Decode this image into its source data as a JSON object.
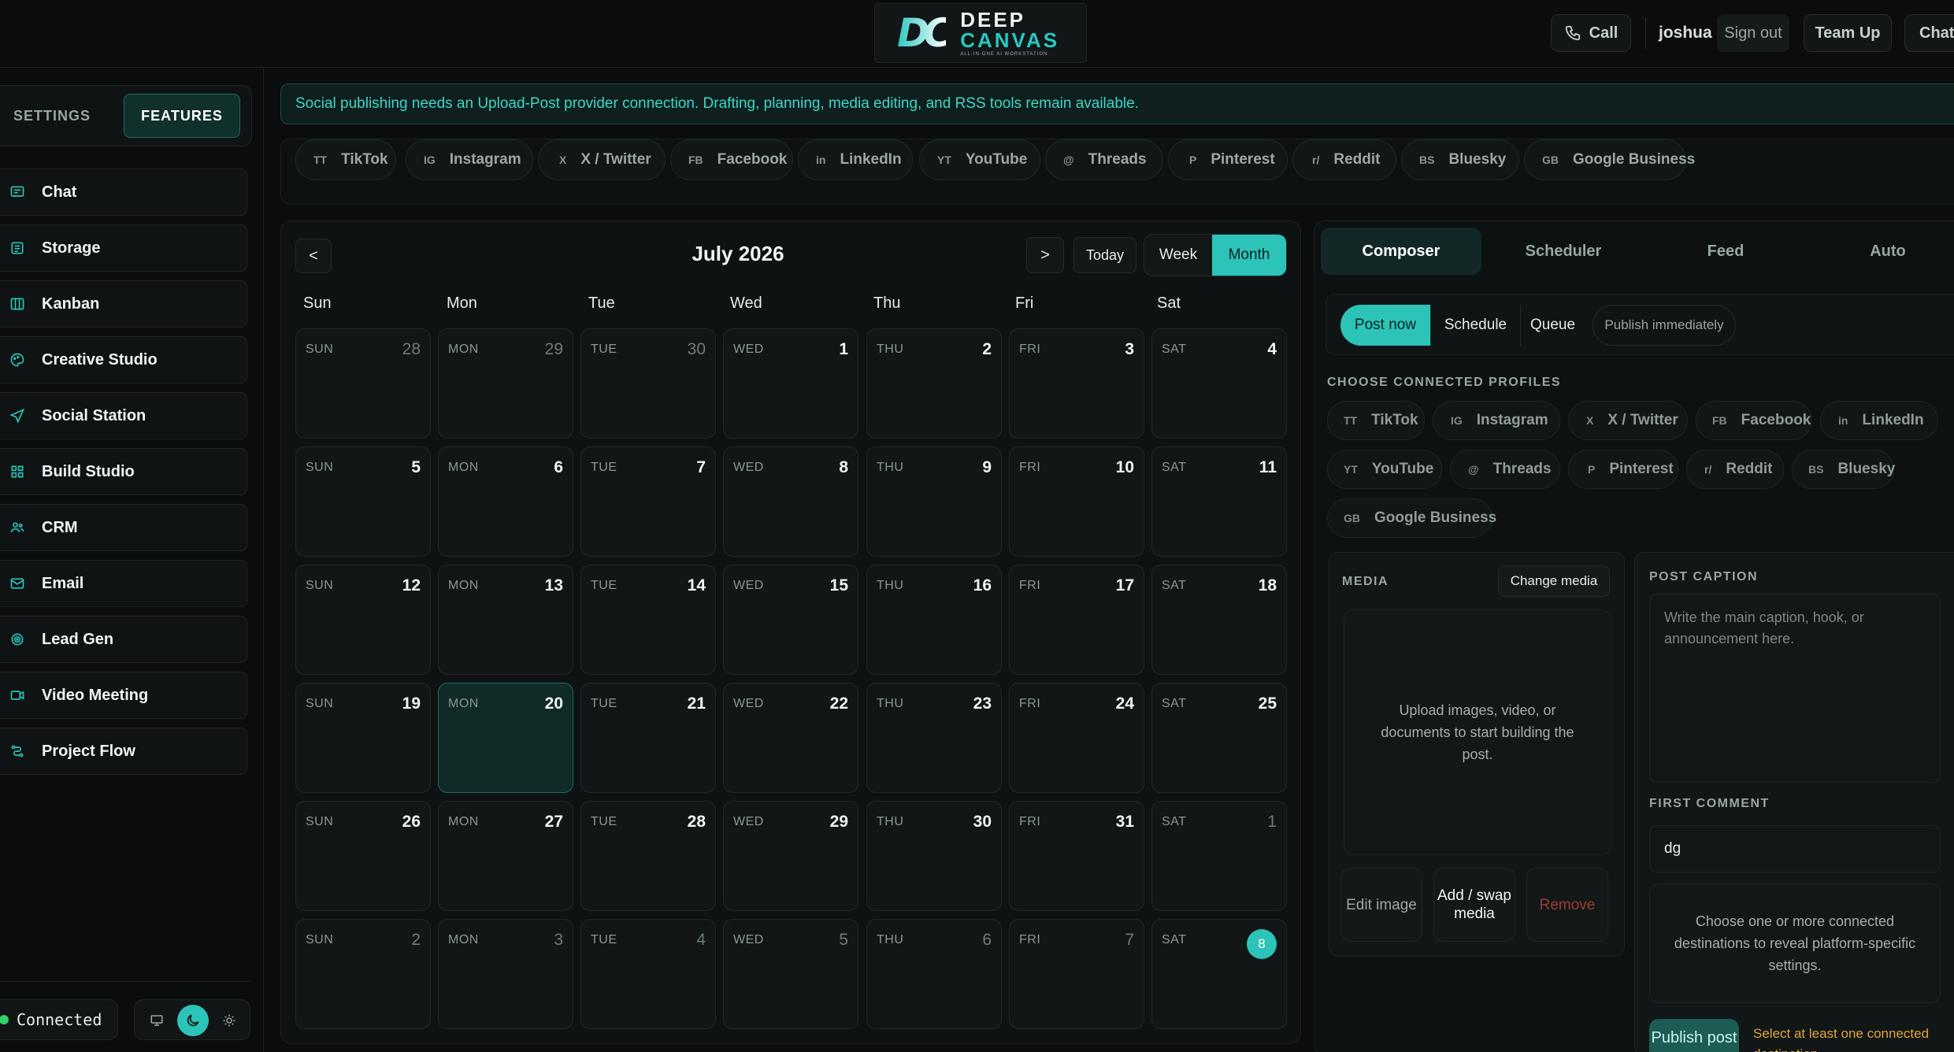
{
  "header": {
    "logo": {
      "mark": "DC",
      "line1": "DEEP",
      "line2": "CANVAS",
      "tagline": "ALL-IN-ONE AI WORKSTATION"
    },
    "call_label": "Call",
    "user": "joshua",
    "sign_out": "Sign out",
    "team_up": "Team Up",
    "chat": "Chat"
  },
  "sidebar": {
    "tabs": {
      "settings": "SETTINGS",
      "features": "FEATURES"
    },
    "items": [
      {
        "label": "Chat",
        "icon": "chat-icon"
      },
      {
        "label": "Storage",
        "icon": "storage-icon"
      },
      {
        "label": "Kanban",
        "icon": "kanban-icon"
      },
      {
        "label": "Creative Studio",
        "icon": "palette-icon"
      },
      {
        "label": "Social Station",
        "icon": "send-icon"
      },
      {
        "label": "Build Studio",
        "icon": "grid-icon"
      },
      {
        "label": "CRM",
        "icon": "users-icon"
      },
      {
        "label": "Email",
        "icon": "mail-icon"
      },
      {
        "label": "Lead Gen",
        "icon": "target-icon"
      },
      {
        "label": "Video Meeting",
        "icon": "video-icon"
      },
      {
        "label": "Project Flow",
        "icon": "flow-icon"
      }
    ],
    "status": "Connected",
    "theme_modes": [
      "monitor-icon",
      "moon-icon",
      "sun-icon"
    ]
  },
  "banner": "Social publishing needs an Upload-Post provider connection. Drafting, planning, media editing, and RSS tools remain available.",
  "platforms": [
    {
      "abbr": "TT",
      "name": "TikTok"
    },
    {
      "abbr": "IG",
      "name": "Instagram"
    },
    {
      "abbr": "X",
      "name": "X / Twitter"
    },
    {
      "abbr": "FB",
      "name": "Facebook"
    },
    {
      "abbr": "in",
      "name": "LinkedIn"
    },
    {
      "abbr": "YT",
      "name": "YouTube"
    },
    {
      "abbr": "@",
      "name": "Threads"
    },
    {
      "abbr": "P",
      "name": "Pinterest"
    },
    {
      "abbr": "r/",
      "name": "Reddit"
    },
    {
      "abbr": "BS",
      "name": "Bluesky"
    },
    {
      "abbr": "GB",
      "name": "Google Business"
    }
  ],
  "calendar": {
    "prev": "<",
    "next": ">",
    "title": "July 2026",
    "today": "Today",
    "week": "Week",
    "month": "Month",
    "weekdays": [
      "Sun",
      "Mon",
      "Tue",
      "Wed",
      "Thu",
      "Fri",
      "Sat"
    ],
    "day_abbr": [
      "SUN",
      "MON",
      "TUE",
      "WED",
      "THU",
      "FRI",
      "SAT"
    ],
    "weeks": [
      [
        "28",
        "29",
        "30",
        "1",
        "2",
        "3",
        "4"
      ],
      [
        "5",
        "6",
        "7",
        "8",
        "9",
        "10",
        "11"
      ],
      [
        "12",
        "13",
        "14",
        "15",
        "16",
        "17",
        "18"
      ],
      [
        "19",
        "20",
        "21",
        "22",
        "23",
        "24",
        "25"
      ],
      [
        "26",
        "27",
        "28",
        "29",
        "30",
        "31",
        "1"
      ],
      [
        "2",
        "3",
        "4",
        "5",
        "6",
        "7",
        "8"
      ]
    ]
  },
  "composer": {
    "tabs": [
      "Composer",
      "Scheduler",
      "Feed",
      "Auto"
    ],
    "modes": {
      "post_now": "Post now",
      "schedule": "Schedule",
      "queue": "Queue",
      "publish_immediately": "Publish immediately"
    },
    "profiles_label": "CHOOSE CONNECTED PROFILES",
    "media_label": "MEDIA",
    "change_media": "Change media",
    "dropzone": "Upload images, video, or documents to start building the post.",
    "edit_image": "Edit image",
    "add_swap": "Add / swap media",
    "remove": "Remove",
    "caption_label": "POST CAPTION",
    "caption_placeholder": "Write the main caption, hook, or announcement here.",
    "first_comment_label": "FIRST COMMENT",
    "first_comment_value": "dg",
    "hint": "Choose one or more connected destinations to reveal platform-specific settings.",
    "publish": "Publish post",
    "publish_warning": "Select at least one connected destination."
  },
  "colors": {
    "accent": "#2cc4b9",
    "warning": "#e2a53a",
    "danger": "#c0392b",
    "status_ok": "#2fd36a"
  }
}
